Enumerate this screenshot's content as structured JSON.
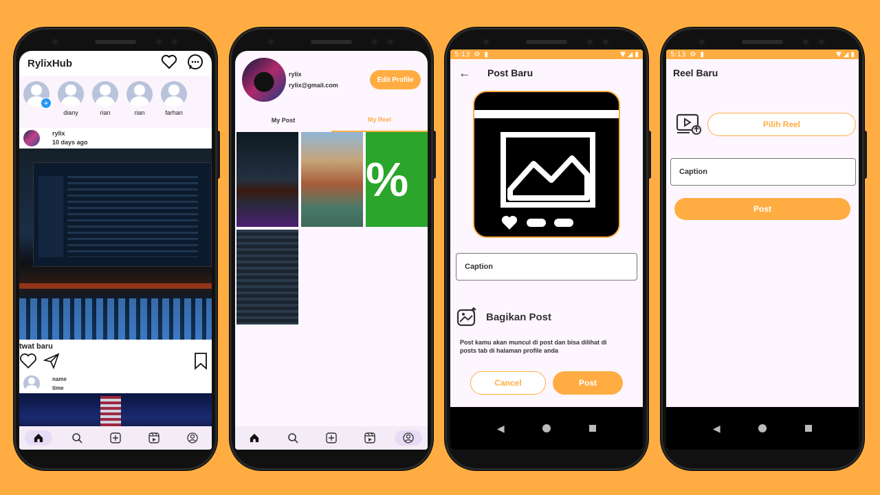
{
  "colors": {
    "accent": "#ffad42",
    "background": "#ffad42",
    "screen": "#fdf6ff"
  },
  "feed": {
    "app_title": "RylixHub",
    "stories": [
      {
        "name": ""
      },
      {
        "name": "diany"
      },
      {
        "name": "rian"
      },
      {
        "name": "rian"
      },
      {
        "name": "farhan"
      }
    ],
    "post": {
      "user": "rylix",
      "time": "10 days ago",
      "caption": "twat baru"
    },
    "comment": {
      "name": "name",
      "time": "time"
    },
    "nav_icons": [
      "home-icon",
      "search-icon",
      "add-icon",
      "reels-icon",
      "profile-icon"
    ]
  },
  "profile": {
    "username": "rylix",
    "email": "rylix@gmail.com",
    "edit_label": "Edit Profile",
    "tabs": [
      "My Post",
      "My Reel"
    ]
  },
  "post_new": {
    "status_time": "5:13",
    "title": "Post Baru",
    "caption_placeholder": "Caption",
    "share_title": "Bagikan Post",
    "share_desc": "Post kamu akan muncul di post dan bisa dilihat di posts tab di halaman profile anda",
    "cancel_label": "Cancel",
    "post_label": "Post"
  },
  "reel_new": {
    "status_time": "5:13",
    "title": "Reel Baru",
    "pick_label": "Pilih Reel",
    "caption_placeholder": "Caption",
    "post_label": "Post"
  }
}
